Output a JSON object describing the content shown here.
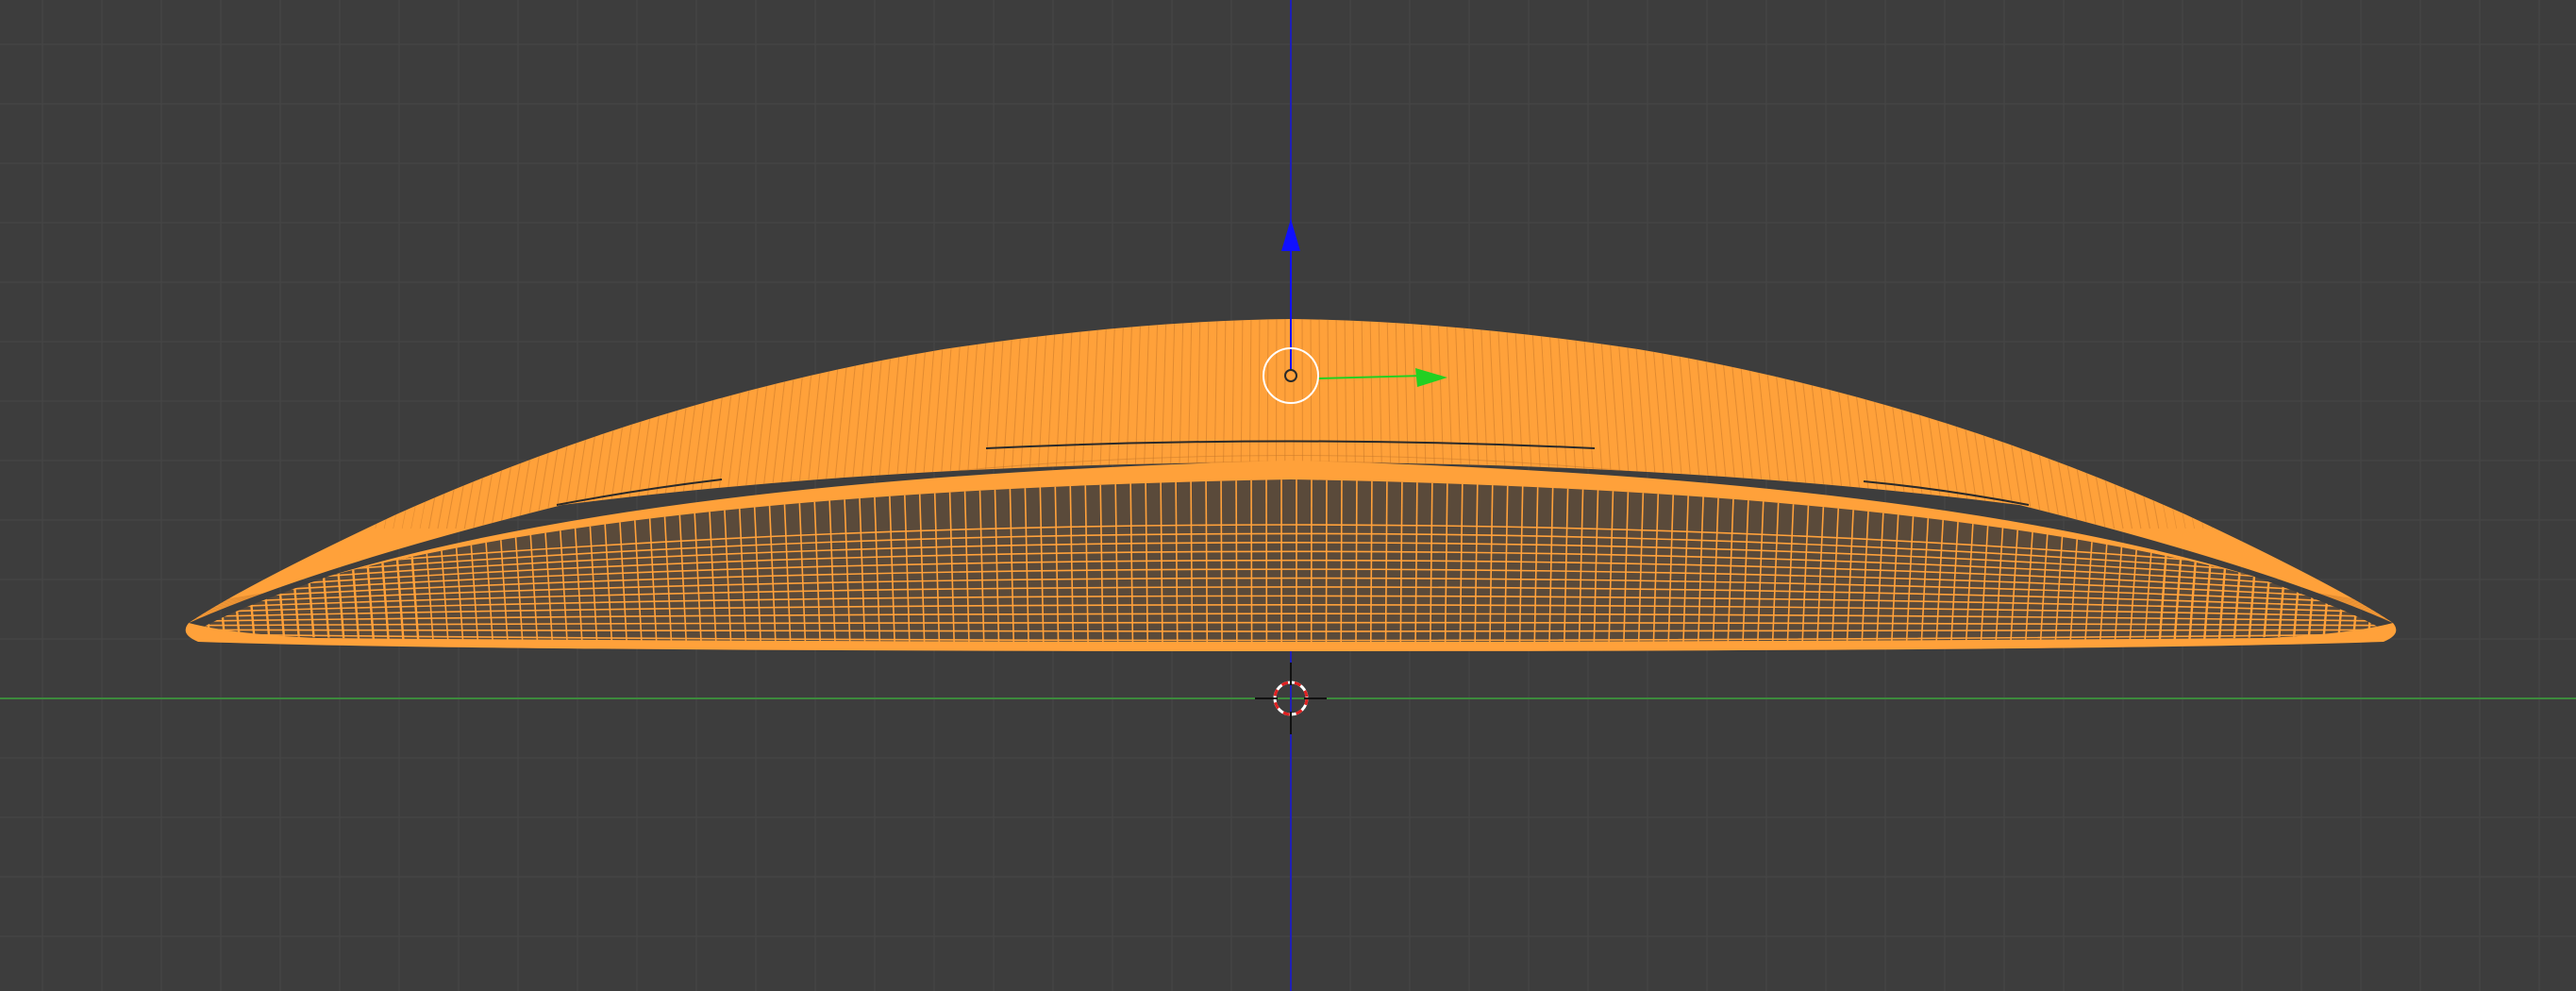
{
  "viewport": {
    "background_color": "#3d3d3d",
    "grid_color": "#474747",
    "x_axis_color": "#3c8a3c",
    "z_axis_color": "#1f1fb8"
  },
  "selected_object": {
    "wire_color": "#ffa13a",
    "wire_shadow_color": "#c8792a"
  },
  "manipulator": {
    "z_handle_color": "#1010ff",
    "y_handle_color": "#22d022",
    "center_ring_color": "#ffffff"
  },
  "icons": {
    "cursor": "3d-cursor-icon",
    "origin": "object-origin-icon",
    "z_arrow": "arrow-up-icon",
    "y_arrow": "arrow-right-icon"
  }
}
